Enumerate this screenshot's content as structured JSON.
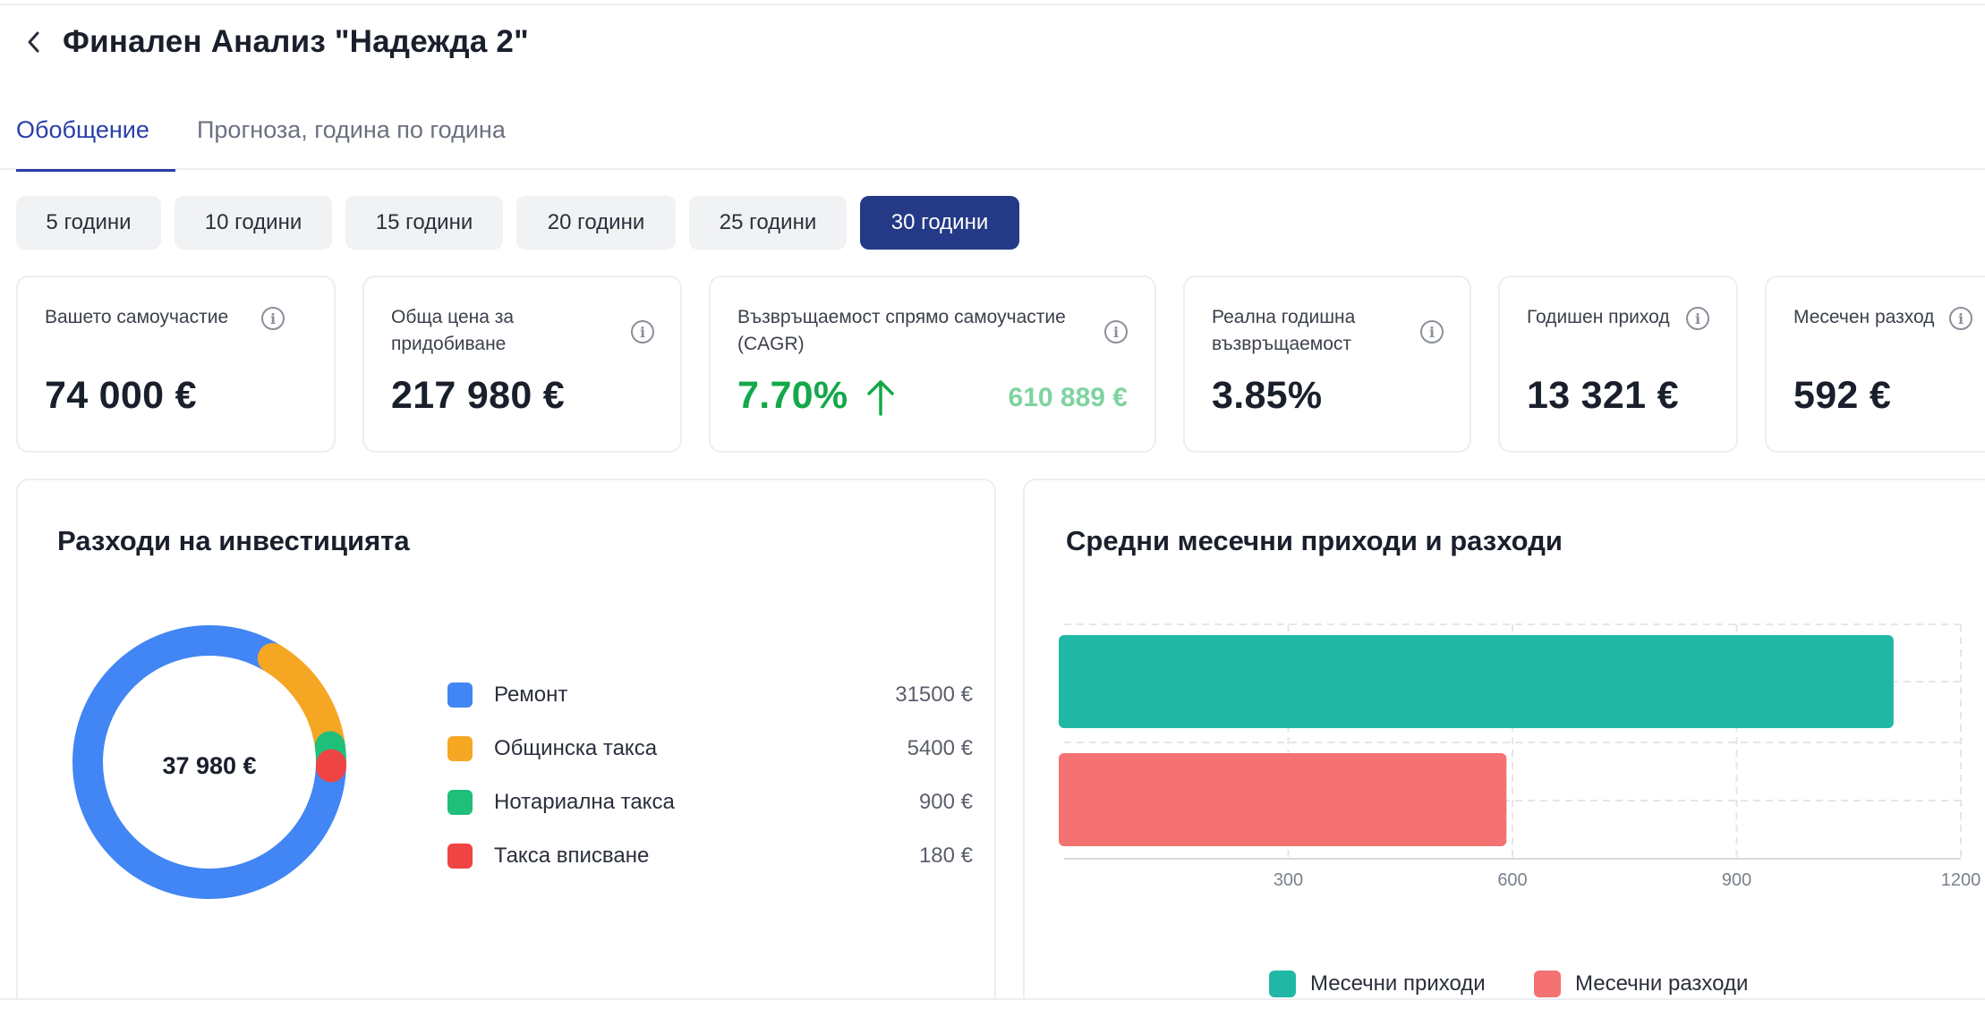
{
  "header": {
    "title": "Финален Анализ \"Надежда 2\""
  },
  "tabs": [
    {
      "label": "Обобщение",
      "active": true
    },
    {
      "label": "Прогноза, година по година",
      "active": false
    }
  ],
  "periods": [
    {
      "label": "5 години",
      "active": false
    },
    {
      "label": "10 години",
      "active": false
    },
    {
      "label": "15 години",
      "active": false
    },
    {
      "label": "20 години",
      "active": false
    },
    {
      "label": "25 години",
      "active": false
    },
    {
      "label": "30 години",
      "active": true
    }
  ],
  "kpis": {
    "own_contribution": {
      "label": "Вашето самоучастие",
      "value": "74 000 €"
    },
    "total_price": {
      "label_line1": "Обща цена за",
      "label_line2": "придобиване",
      "value": "217 980 €"
    },
    "cagr": {
      "label_line1": "Възвръщаемост спрямо самоучастие",
      "label_line2": "(CAGR)",
      "value": "7.70%",
      "extra": "610 889 €"
    },
    "real_return": {
      "label_line1": "Реална годишна",
      "label_line2": "възвръщаемост",
      "value": "3.85%"
    },
    "annual_income": {
      "label": "Годишен приход",
      "value": "13 321 €"
    },
    "monthly_expense": {
      "label": "Месечен разход",
      "value": "592 €"
    }
  },
  "costs_panel": {
    "title": "Разходи на инвестицията",
    "total": "37 980 €",
    "items": [
      {
        "label": "Ремонт",
        "value": "31500 €",
        "amount": 31500,
        "color": "#4285f4"
      },
      {
        "label": "Общинска такса",
        "value": "5400 €",
        "amount": 5400,
        "color": "#f5a623"
      },
      {
        "label": "Нотариална такса",
        "value": "900 €",
        "amount": 900,
        "color": "#1fbf7a"
      },
      {
        "label": "Такса вписване",
        "value": "180 €",
        "amount": 180,
        "color": "#ef4444"
      }
    ]
  },
  "chart_data": {
    "type": "bar",
    "orientation": "horizontal",
    "title": "Средни месечни приходи и разходи",
    "series": [
      {
        "name": "Месечни приходи",
        "value": 1110,
        "color": "#20b8a5"
      },
      {
        "name": "Месечни разходи",
        "value": 592,
        "color": "#f47272"
      }
    ],
    "xlim": [
      0,
      1200
    ],
    "x_ticks": [
      300,
      600,
      900,
      1200
    ],
    "x_tick_labels": [
      "300",
      "600",
      "900",
      "1200"
    ],
    "grid": true,
    "legend_position": "bottom"
  }
}
